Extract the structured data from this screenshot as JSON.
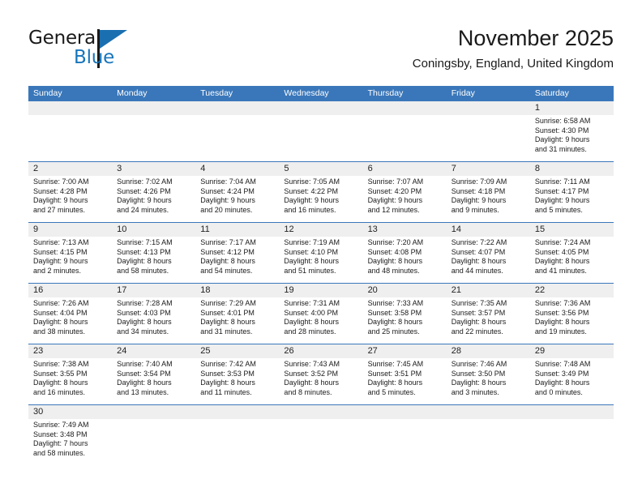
{
  "brand": {
    "name_part1": "General",
    "name_part2": "Blue",
    "flag_icon": "triangle-flag-icon"
  },
  "header": {
    "title": "November 2025",
    "subtitle": "Coningsby, England, United Kingdom"
  },
  "colors": {
    "header_blue": "#3a77ba",
    "brand_blue": "#1675bb",
    "band_gray": "#efefef",
    "text": "#1a1a1a"
  },
  "weekdays": [
    "Sunday",
    "Monday",
    "Tuesday",
    "Wednesday",
    "Thursday",
    "Friday",
    "Saturday"
  ],
  "weeks": [
    [
      {
        "empty": true
      },
      {
        "empty": true
      },
      {
        "empty": true
      },
      {
        "empty": true
      },
      {
        "empty": true
      },
      {
        "empty": true
      },
      {
        "day": "1",
        "sunrise": "Sunrise: 6:58 AM",
        "sunset": "Sunset: 4:30 PM",
        "daylight1": "Daylight: 9 hours",
        "daylight2": "and 31 minutes."
      }
    ],
    [
      {
        "day": "2",
        "sunrise": "Sunrise: 7:00 AM",
        "sunset": "Sunset: 4:28 PM",
        "daylight1": "Daylight: 9 hours",
        "daylight2": "and 27 minutes."
      },
      {
        "day": "3",
        "sunrise": "Sunrise: 7:02 AM",
        "sunset": "Sunset: 4:26 PM",
        "daylight1": "Daylight: 9 hours",
        "daylight2": "and 24 minutes."
      },
      {
        "day": "4",
        "sunrise": "Sunrise: 7:04 AM",
        "sunset": "Sunset: 4:24 PM",
        "daylight1": "Daylight: 9 hours",
        "daylight2": "and 20 minutes."
      },
      {
        "day": "5",
        "sunrise": "Sunrise: 7:05 AM",
        "sunset": "Sunset: 4:22 PM",
        "daylight1": "Daylight: 9 hours",
        "daylight2": "and 16 minutes."
      },
      {
        "day": "6",
        "sunrise": "Sunrise: 7:07 AM",
        "sunset": "Sunset: 4:20 PM",
        "daylight1": "Daylight: 9 hours",
        "daylight2": "and 12 minutes."
      },
      {
        "day": "7",
        "sunrise": "Sunrise: 7:09 AM",
        "sunset": "Sunset: 4:18 PM",
        "daylight1": "Daylight: 9 hours",
        "daylight2": "and 9 minutes."
      },
      {
        "day": "8",
        "sunrise": "Sunrise: 7:11 AM",
        "sunset": "Sunset: 4:17 PM",
        "daylight1": "Daylight: 9 hours",
        "daylight2": "and 5 minutes."
      }
    ],
    [
      {
        "day": "9",
        "sunrise": "Sunrise: 7:13 AM",
        "sunset": "Sunset: 4:15 PM",
        "daylight1": "Daylight: 9 hours",
        "daylight2": "and 2 minutes."
      },
      {
        "day": "10",
        "sunrise": "Sunrise: 7:15 AM",
        "sunset": "Sunset: 4:13 PM",
        "daylight1": "Daylight: 8 hours",
        "daylight2": "and 58 minutes."
      },
      {
        "day": "11",
        "sunrise": "Sunrise: 7:17 AM",
        "sunset": "Sunset: 4:12 PM",
        "daylight1": "Daylight: 8 hours",
        "daylight2": "and 54 minutes."
      },
      {
        "day": "12",
        "sunrise": "Sunrise: 7:19 AM",
        "sunset": "Sunset: 4:10 PM",
        "daylight1": "Daylight: 8 hours",
        "daylight2": "and 51 minutes."
      },
      {
        "day": "13",
        "sunrise": "Sunrise: 7:20 AM",
        "sunset": "Sunset: 4:08 PM",
        "daylight1": "Daylight: 8 hours",
        "daylight2": "and 48 minutes."
      },
      {
        "day": "14",
        "sunrise": "Sunrise: 7:22 AM",
        "sunset": "Sunset: 4:07 PM",
        "daylight1": "Daylight: 8 hours",
        "daylight2": "and 44 minutes."
      },
      {
        "day": "15",
        "sunrise": "Sunrise: 7:24 AM",
        "sunset": "Sunset: 4:05 PM",
        "daylight1": "Daylight: 8 hours",
        "daylight2": "and 41 minutes."
      }
    ],
    [
      {
        "day": "16",
        "sunrise": "Sunrise: 7:26 AM",
        "sunset": "Sunset: 4:04 PM",
        "daylight1": "Daylight: 8 hours",
        "daylight2": "and 38 minutes."
      },
      {
        "day": "17",
        "sunrise": "Sunrise: 7:28 AM",
        "sunset": "Sunset: 4:03 PM",
        "daylight1": "Daylight: 8 hours",
        "daylight2": "and 34 minutes."
      },
      {
        "day": "18",
        "sunrise": "Sunrise: 7:29 AM",
        "sunset": "Sunset: 4:01 PM",
        "daylight1": "Daylight: 8 hours",
        "daylight2": "and 31 minutes."
      },
      {
        "day": "19",
        "sunrise": "Sunrise: 7:31 AM",
        "sunset": "Sunset: 4:00 PM",
        "daylight1": "Daylight: 8 hours",
        "daylight2": "and 28 minutes."
      },
      {
        "day": "20",
        "sunrise": "Sunrise: 7:33 AM",
        "sunset": "Sunset: 3:58 PM",
        "daylight1": "Daylight: 8 hours",
        "daylight2": "and 25 minutes."
      },
      {
        "day": "21",
        "sunrise": "Sunrise: 7:35 AM",
        "sunset": "Sunset: 3:57 PM",
        "daylight1": "Daylight: 8 hours",
        "daylight2": "and 22 minutes."
      },
      {
        "day": "22",
        "sunrise": "Sunrise: 7:36 AM",
        "sunset": "Sunset: 3:56 PM",
        "daylight1": "Daylight: 8 hours",
        "daylight2": "and 19 minutes."
      }
    ],
    [
      {
        "day": "23",
        "sunrise": "Sunrise: 7:38 AM",
        "sunset": "Sunset: 3:55 PM",
        "daylight1": "Daylight: 8 hours",
        "daylight2": "and 16 minutes."
      },
      {
        "day": "24",
        "sunrise": "Sunrise: 7:40 AM",
        "sunset": "Sunset: 3:54 PM",
        "daylight1": "Daylight: 8 hours",
        "daylight2": "and 13 minutes."
      },
      {
        "day": "25",
        "sunrise": "Sunrise: 7:42 AM",
        "sunset": "Sunset: 3:53 PM",
        "daylight1": "Daylight: 8 hours",
        "daylight2": "and 11 minutes."
      },
      {
        "day": "26",
        "sunrise": "Sunrise: 7:43 AM",
        "sunset": "Sunset: 3:52 PM",
        "daylight1": "Daylight: 8 hours",
        "daylight2": "and 8 minutes."
      },
      {
        "day": "27",
        "sunrise": "Sunrise: 7:45 AM",
        "sunset": "Sunset: 3:51 PM",
        "daylight1": "Daylight: 8 hours",
        "daylight2": "and 5 minutes."
      },
      {
        "day": "28",
        "sunrise": "Sunrise: 7:46 AM",
        "sunset": "Sunset: 3:50 PM",
        "daylight1": "Daylight: 8 hours",
        "daylight2": "and 3 minutes."
      },
      {
        "day": "29",
        "sunrise": "Sunrise: 7:48 AM",
        "sunset": "Sunset: 3:49 PM",
        "daylight1": "Daylight: 8 hours",
        "daylight2": "and 0 minutes."
      }
    ],
    [
      {
        "day": "30",
        "sunrise": "Sunrise: 7:49 AM",
        "sunset": "Sunset: 3:48 PM",
        "daylight1": "Daylight: 7 hours",
        "daylight2": "and 58 minutes."
      },
      {
        "empty": true
      },
      {
        "empty": true
      },
      {
        "empty": true
      },
      {
        "empty": true
      },
      {
        "empty": true
      },
      {
        "empty": true
      }
    ]
  ]
}
